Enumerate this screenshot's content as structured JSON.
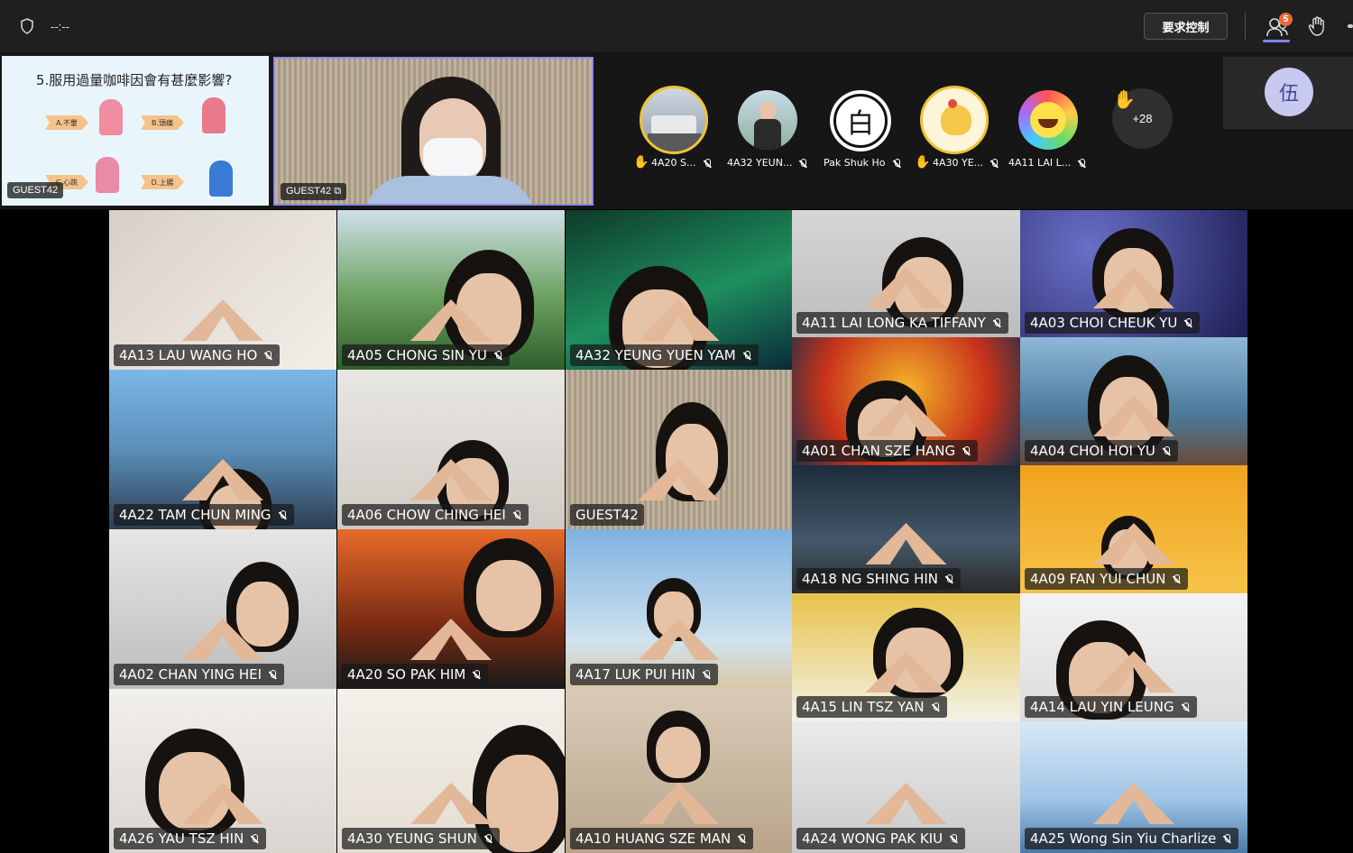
{
  "top_bar": {
    "timer": "--:--",
    "request_control_label": "要求控制",
    "participants_badge": "5"
  },
  "stage": {
    "slide": {
      "title": "5.服用過量咖啡因會有甚麼影響?",
      "options": [
        "A.不暈",
        "B.頭痛",
        "C.心跳",
        "D.上腸"
      ],
      "owner": "GUEST42"
    },
    "presenter": {
      "name": "GUEST42"
    }
  },
  "gallery_strip": [
    {
      "name": "4A20 S...",
      "hand_raised": true
    },
    {
      "name": "4A32 YEUN...",
      "hand_raised": false
    },
    {
      "name": "Pak Shuk Ho",
      "hand_raised": false,
      "glyph": "白"
    },
    {
      "name": "4A30 YE...",
      "hand_raised": true
    },
    {
      "name": "4A11 LAI L...",
      "hand_raised": false
    }
  ],
  "overflow": {
    "label": "+28"
  },
  "self": {
    "initial": "伍"
  },
  "grid": [
    {
      "name": "4A13 LAU WANG HO"
    },
    {
      "name": "4A05 CHONG SIN YU"
    },
    {
      "name": "4A32 YEUNG YUEN YAM"
    },
    {
      "name": "4A11 LAI LONG KA TIFFANY"
    },
    {
      "name": "4A03 CHOI CHEUK YU"
    },
    {
      "name": "4A01 CHAN SZE HANG"
    },
    {
      "name": "4A04 CHOI HOI YU"
    },
    {
      "name": "4A22 TAM CHUN MING"
    },
    {
      "name": "4A06 CHOW CHING HEI"
    },
    {
      "name": "GUEST42"
    },
    {
      "name": "4A18 NG SHING HIN"
    },
    {
      "name": "4A09 FAN YUI CHUN"
    },
    {
      "name": "4A02 CHAN YING HEI"
    },
    {
      "name": "4A20 SO PAK HIM"
    },
    {
      "name": "4A17 LUK PUI HIN"
    },
    {
      "name": "4A15 LIN TSZ YAN"
    },
    {
      "name": "4A14 LAU YIN LEUNG"
    },
    {
      "name": "4A26 YAU TSZ HIN"
    },
    {
      "name": "4A30 YEUNG SHUN"
    },
    {
      "name": "4A10 HUANG SZE MAN"
    },
    {
      "name": "4A24 WONG PAK KIU"
    },
    {
      "name": "4A25 Wong Sin Yiu Charlize"
    }
  ]
}
